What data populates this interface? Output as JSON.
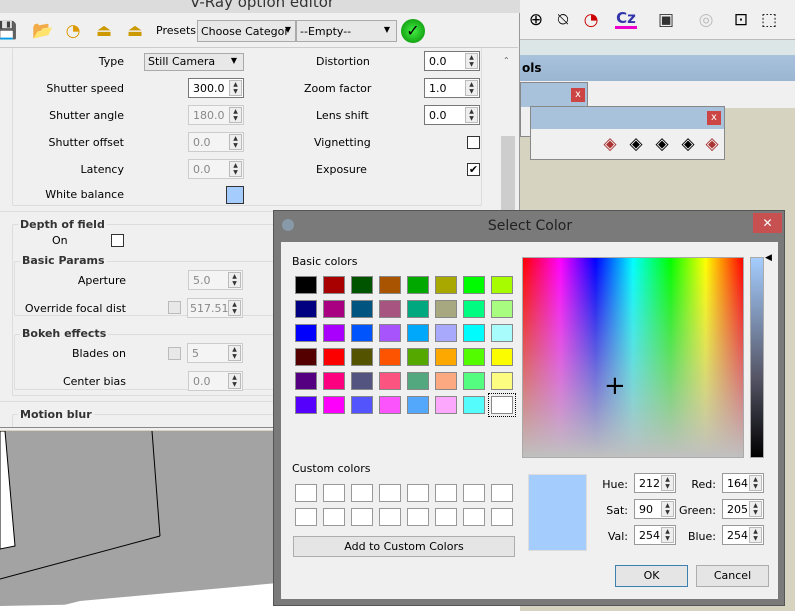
{
  "vray": {
    "title": "V-Ray option editor",
    "toolbar": {
      "icons": [
        "save-icon",
        "open-icon",
        "reset-icon",
        "import-icon",
        "export-icon"
      ],
      "presets_label": "Presets:",
      "category": "Choose Categor",
      "preset": "--Empty--"
    },
    "camera": {
      "type_label": "Type",
      "type_value": "Still Camera",
      "shutter_speed_label": "Shutter speed",
      "shutter_speed": "300.0",
      "shutter_angle_label": "Shutter angle",
      "shutter_angle": "180.0",
      "shutter_offset_label": "Shutter offset",
      "shutter_offset": "0.0",
      "latency_label": "Latency",
      "latency": "0.0",
      "white_balance_label": "White balance",
      "white_balance_color": "#a4cdfe",
      "distortion_label": "Distortion",
      "distortion": "0.0",
      "zoom_label": "Zoom factor",
      "zoom": "1.0",
      "lens_shift_label": "Lens shift",
      "lens_shift": "0.0",
      "vignetting_label": "Vignetting",
      "vignetting": false,
      "exposure_label": "Exposure",
      "exposure": true
    },
    "dof": {
      "title": "Depth of field",
      "on_label": "On",
      "on": false,
      "basic_title": "Basic Params",
      "aperture_label": "Aperture",
      "aperture": "5.0",
      "override_label": "Override focal dist",
      "override_value": "517.517",
      "bokeh_title": "Bokeh effects",
      "blades_label": "Blades on",
      "blades": "5",
      "center_bias_label": "Center bias",
      "center_bias": "0.0"
    },
    "motion_blur": {
      "title": "Motion blur"
    }
  },
  "sketchup": {
    "panel_title": "ols",
    "close": "x"
  },
  "dialog": {
    "title": "Select Color",
    "close": "✕",
    "basic_label": "Basic colors",
    "basic_colors": [
      "#000000",
      "#a80000",
      "#005400",
      "#a85400",
      "#00a800",
      "#a8a800",
      "#00fc00",
      "#a8fc00",
      "#000080",
      "#a80080",
      "#005480",
      "#a85480",
      "#00a880",
      "#a8a880",
      "#00fc80",
      "#a8fc80",
      "#0000fc",
      "#a800fc",
      "#0054fc",
      "#a854fc",
      "#00a8fc",
      "#a8a8fc",
      "#00fcfc",
      "#a8fcfc",
      "#540000",
      "#fc0000",
      "#545400",
      "#fc5400",
      "#54a800",
      "#fca800",
      "#54fc00",
      "#fcfc00",
      "#540080",
      "#fc0080",
      "#545480",
      "#fc5480",
      "#54a880",
      "#fca880",
      "#54fc80",
      "#fcfc80",
      "#5400fc",
      "#fc00fc",
      "#5454fc",
      "#fc54fc",
      "#54a8fc",
      "#fca8fc",
      "#54fcfc",
      "#ffffff"
    ],
    "custom_label": "Custom colors",
    "add_custom": "Add to Custom Colors",
    "preview_color": "#a4cdfe",
    "hue_label": "Hue:",
    "hue": "212",
    "sat_label": "Sat:",
    "sat": "90",
    "val_label": "Val:",
    "val": "254",
    "red_label": "Red:",
    "red": "164",
    "green_label": "Green:",
    "green": "205",
    "blue_label": "Blue:",
    "blue": "254",
    "ok": "OK",
    "cancel": "Cancel"
  }
}
